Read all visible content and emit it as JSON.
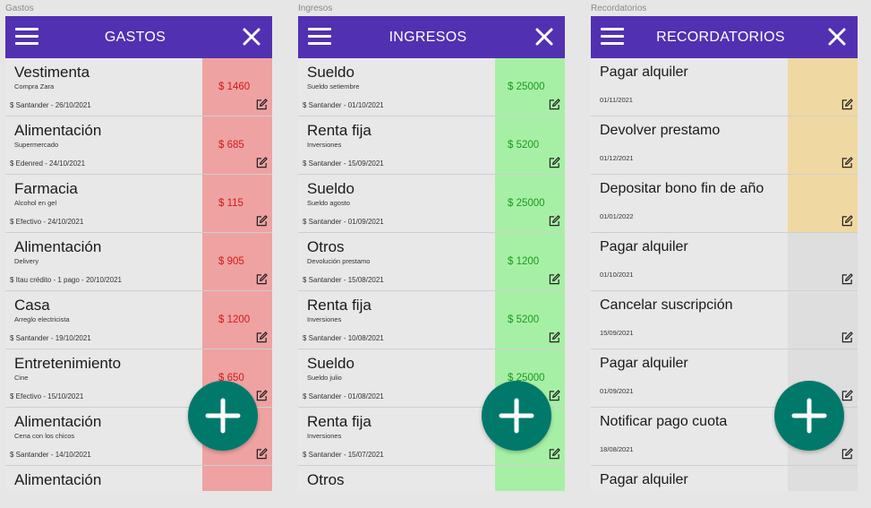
{
  "screens": {
    "gastos": {
      "label": "Gastos",
      "title": "GASTOS",
      "items": [
        {
          "title": "Vestimenta",
          "subtitle": "Compra Zara",
          "meta": "$ Santander - 26/10/2021",
          "amount": "$ 1460"
        },
        {
          "title": "Alimentación",
          "subtitle": "Supermercado",
          "meta": "$ Edenred - 24/10/2021",
          "amount": "$ 685"
        },
        {
          "title": "Farmacia",
          "subtitle": "Alcohol en gel",
          "meta": "$ Efectivo - 24/10/2021",
          "amount": "$ 115"
        },
        {
          "title": "Alimentación",
          "subtitle": "Delivery",
          "meta": "$ Itau crédito - 1 pago -  20/10/2021",
          "amount": "$ 905"
        },
        {
          "title": "Casa",
          "subtitle": "Arreglo electricista",
          "meta": "$ Santander - 19/10/2021",
          "amount": "$ 1200"
        },
        {
          "title": "Entretenimiento",
          "subtitle": "Cine",
          "meta": "$ Efectivo - 15/10/2021",
          "amount": "$ 650"
        },
        {
          "title": "Alimentación",
          "subtitle": "Cena con los chicos",
          "meta": "$ Santander - 14/10/2021",
          "amount": ""
        },
        {
          "title": "Alimentación",
          "subtitle": "",
          "meta": "",
          "amount": ""
        }
      ]
    },
    "ingresos": {
      "label": "Ingresos",
      "title": "INGRESOS",
      "items": [
        {
          "title": "Sueldo",
          "subtitle": "Sueldo setiembre",
          "meta": "$ Santander - 01/10/2021",
          "amount": "$ 25000"
        },
        {
          "title": "Renta fija",
          "subtitle": "Inversiones",
          "meta": "$ Santander - 15/09/2021",
          "amount": "$ 5200"
        },
        {
          "title": "Sueldo",
          "subtitle": "Sueldo agosto",
          "meta": "$ Santander - 01/09/2021",
          "amount": "$ 25000"
        },
        {
          "title": "Otros",
          "subtitle": "Devolución prestamo",
          "meta": "$ Santander - 15/08/2021",
          "amount": "$ 1200"
        },
        {
          "title": "Renta fija",
          "subtitle": "Inversiones",
          "meta": "$ Santander - 10/08/2021",
          "amount": "$ 5200"
        },
        {
          "title": "Sueldo",
          "subtitle": "Sueldo julio",
          "meta": "$ Santander - 01/08/2021",
          "amount": "$ 25000"
        },
        {
          "title": "Renta fija",
          "subtitle": "Inversiones",
          "meta": "$ Santander - 15/07/2021",
          "amount": ""
        },
        {
          "title": "Otros",
          "subtitle": "",
          "meta": "",
          "amount": ""
        }
      ]
    },
    "recordatorios": {
      "label": "Recordatorios",
      "title": "RECORDATORIOS",
      "items": [
        {
          "title": "Pagar alquiler",
          "date": "01/11/2021",
          "status": "pending"
        },
        {
          "title": "Devolver prestamo",
          "date": "01/12/2021",
          "status": "pending"
        },
        {
          "title": "Depositar bono fin de año",
          "date": "01/01/2022",
          "status": "pending"
        },
        {
          "title": "Pagar alquiler",
          "date": "01/10/2021",
          "status": "done"
        },
        {
          "title": "Cancelar suscripción",
          "date": "15/09/2021",
          "status": "done"
        },
        {
          "title": "Pagar alquiler",
          "date": "01/09/2021",
          "status": "done"
        },
        {
          "title": "Notificar pago cuota",
          "date": "18/08/2021",
          "status": "done"
        },
        {
          "title": "Pagar alquiler",
          "date": "",
          "status": "done"
        }
      ]
    }
  },
  "colors": {
    "appbar": "#5230b2",
    "fab": "#00796b",
    "expense_side": "#efa2a2",
    "expense_amount": "#d21a1a",
    "income_side": "#a6f0a6",
    "income_amount": "#1c9a1c",
    "reminder_pending": "#f0d8a2",
    "reminder_done": "#dedede"
  },
  "icons": {
    "menu": "menu-icon",
    "close": "close-icon",
    "edit": "edit-icon",
    "add": "add-icon"
  }
}
